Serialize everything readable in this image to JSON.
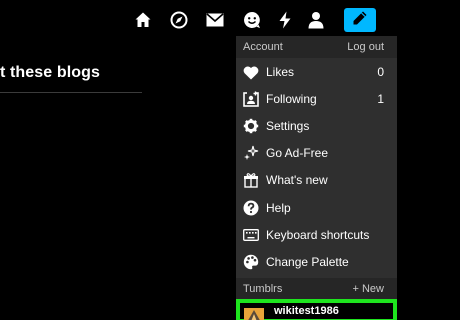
{
  "nav": {
    "icons": [
      "home-icon",
      "explore-compass-icon",
      "inbox-envelope-icon",
      "messaging-smiley-icon",
      "activity-lightning-icon",
      "account-person-icon"
    ],
    "compose_icon": "pencil-icon",
    "accent_color": "#00b8ff"
  },
  "left": {
    "heading": "t these blogs"
  },
  "menu": {
    "account_label": "Account",
    "logout_label": "Log out",
    "items": [
      {
        "label": "Likes",
        "count": "0",
        "icon": "heart-icon"
      },
      {
        "label": "Following",
        "count": "1",
        "icon": "following-person-icon"
      },
      {
        "label": "Settings",
        "count": "",
        "icon": "gear-icon"
      },
      {
        "label": "Go Ad-Free",
        "count": "",
        "icon": "sparkles-icon"
      },
      {
        "label": "What's new",
        "count": "",
        "icon": "gift-icon"
      },
      {
        "label": "Help",
        "count": "",
        "icon": "help-icon"
      },
      {
        "label": "Keyboard shortcuts",
        "count": "",
        "icon": "keyboard-icon"
      },
      {
        "label": "Change Palette",
        "count": "",
        "icon": "palette-icon"
      }
    ],
    "tumblrs_label": "Tumblrs",
    "new_label": "+ New",
    "blog_name": "wikitest1986",
    "highlight_color": "#1ee51e"
  }
}
